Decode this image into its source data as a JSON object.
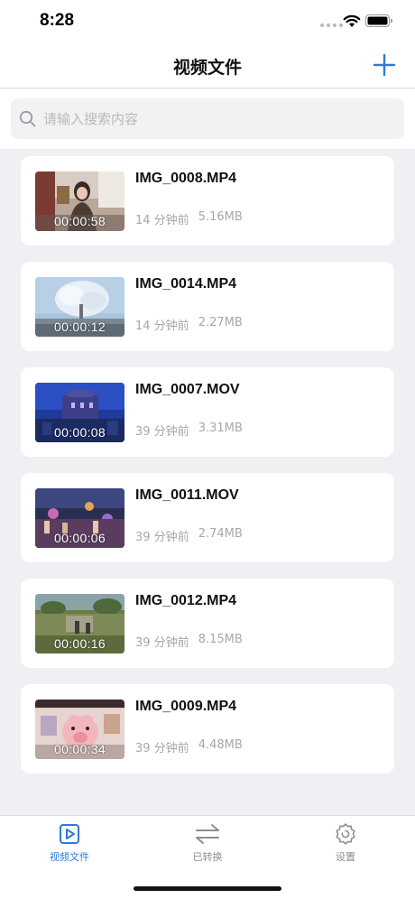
{
  "status_bar": {
    "time": "8:28"
  },
  "nav": {
    "title": "视频文件",
    "add_icon": "plus-icon"
  },
  "search": {
    "placeholder": "请输入搜索内容",
    "value": ""
  },
  "videos": [
    {
      "name": "IMG_0008.MP4",
      "duration": "00:00:58",
      "time_ago": "14 分钟前",
      "size": "5.16MB"
    },
    {
      "name": "IMG_0014.MP4",
      "duration": "00:00:12",
      "time_ago": "14 分钟前",
      "size": "2.27MB"
    },
    {
      "name": "IMG_0007.MOV",
      "duration": "00:00:08",
      "time_ago": "39 分钟前",
      "size": "3.31MB"
    },
    {
      "name": "IMG_0011.MOV",
      "duration": "00:00:06",
      "time_ago": "39 分钟前",
      "size": "2.74MB"
    },
    {
      "name": "IMG_0012.MP4",
      "duration": "00:00:16",
      "time_ago": "39 分钟前",
      "size": "8.15MB"
    },
    {
      "name": "IMG_0009.MP4",
      "duration": "00:00:34",
      "time_ago": "39 分钟前",
      "size": "4.48MB"
    }
  ],
  "tabs": [
    {
      "label": "视频文件",
      "icon": "video-file-icon",
      "active": true
    },
    {
      "label": "已转换",
      "icon": "convert-arrows-icon",
      "active": false
    },
    {
      "label": "设置",
      "icon": "settings-gear-icon",
      "active": false
    }
  ],
  "colors": {
    "accent": "#2e7ad6",
    "background": "#efeff4",
    "muted_text": "#a7a7ac"
  }
}
